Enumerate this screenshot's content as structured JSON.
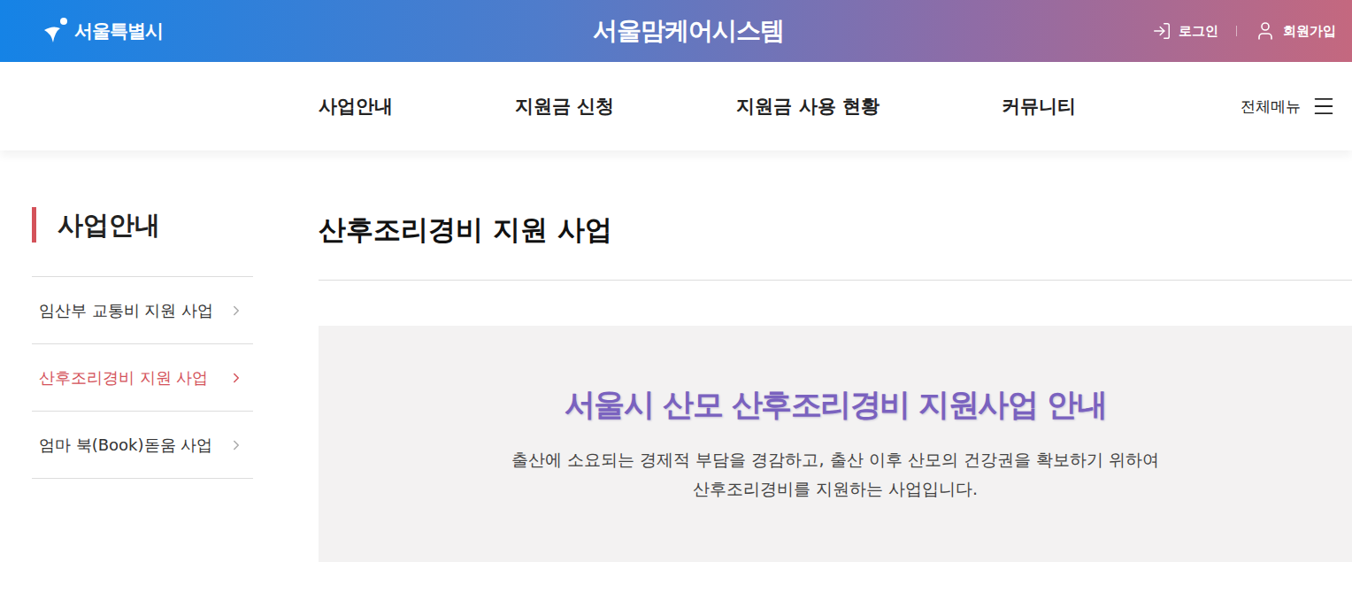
{
  "header": {
    "logo": "서울특별시",
    "title": "서울맘케어시스템",
    "links": [
      {
        "label": "로그인",
        "kind": "login"
      },
      {
        "label": "회원가입",
        "kind": "join"
      }
    ]
  },
  "nav": {
    "items": [
      "사업안내",
      "지원금 신청",
      "지원금 사용 현황",
      "커뮤니티"
    ],
    "all_menu": "전체메뉴"
  },
  "sidebar": {
    "title": "사업안내",
    "items": [
      {
        "label": "임산부 교통비 지원 사업",
        "selected": false
      },
      {
        "label": "산후조리경비 지원 사업",
        "selected": true
      },
      {
        "label": "엄마 북(Book)돋움 사업",
        "selected": false
      }
    ]
  },
  "page": {
    "title": "산후조리경비 지원 사업",
    "banner": {
      "title": "서울시 산모 산후조리경비 지원사업 안내",
      "description": [
        "출산에 소요되는 경제적 부담을 경감하고, 출산 이후 산모의 건강권을 확보하기 위하여",
        "산후조리경비를 지원하는 사업입니다."
      ]
    }
  }
}
